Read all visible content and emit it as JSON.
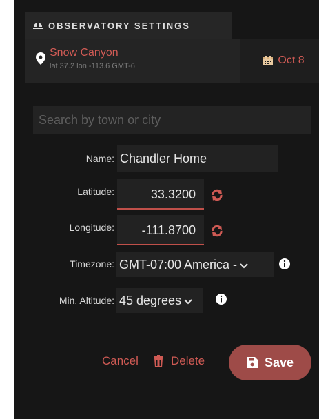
{
  "header": {
    "title": "OBSERVATORY SETTINGS",
    "icon": "observatory-dome-icon"
  },
  "location": {
    "name": "Snow Canyon",
    "details": "lat 37.2 lon -113.6 GMT-6",
    "date": "Oct 8",
    "accent": "#d15b55"
  },
  "search": {
    "placeholder": "Search by town or city",
    "value": ""
  },
  "form": {
    "name_label": "Name:",
    "name_value": "Chandler Home",
    "latitude_label": "Latitude:",
    "latitude_value": "33.3200",
    "longitude_label": "Longitude:",
    "longitude_value": "-111.8700",
    "timezone_label": "Timezone:",
    "timezone_value": "GMT-07:00 America -",
    "min_altitude_label": "Min. Altitude:",
    "min_altitude_value": "45 degrees"
  },
  "actions": {
    "cancel_label": "Cancel",
    "delete_label": "Delete",
    "save_label": "Save",
    "save_color": "#9e4b48"
  }
}
